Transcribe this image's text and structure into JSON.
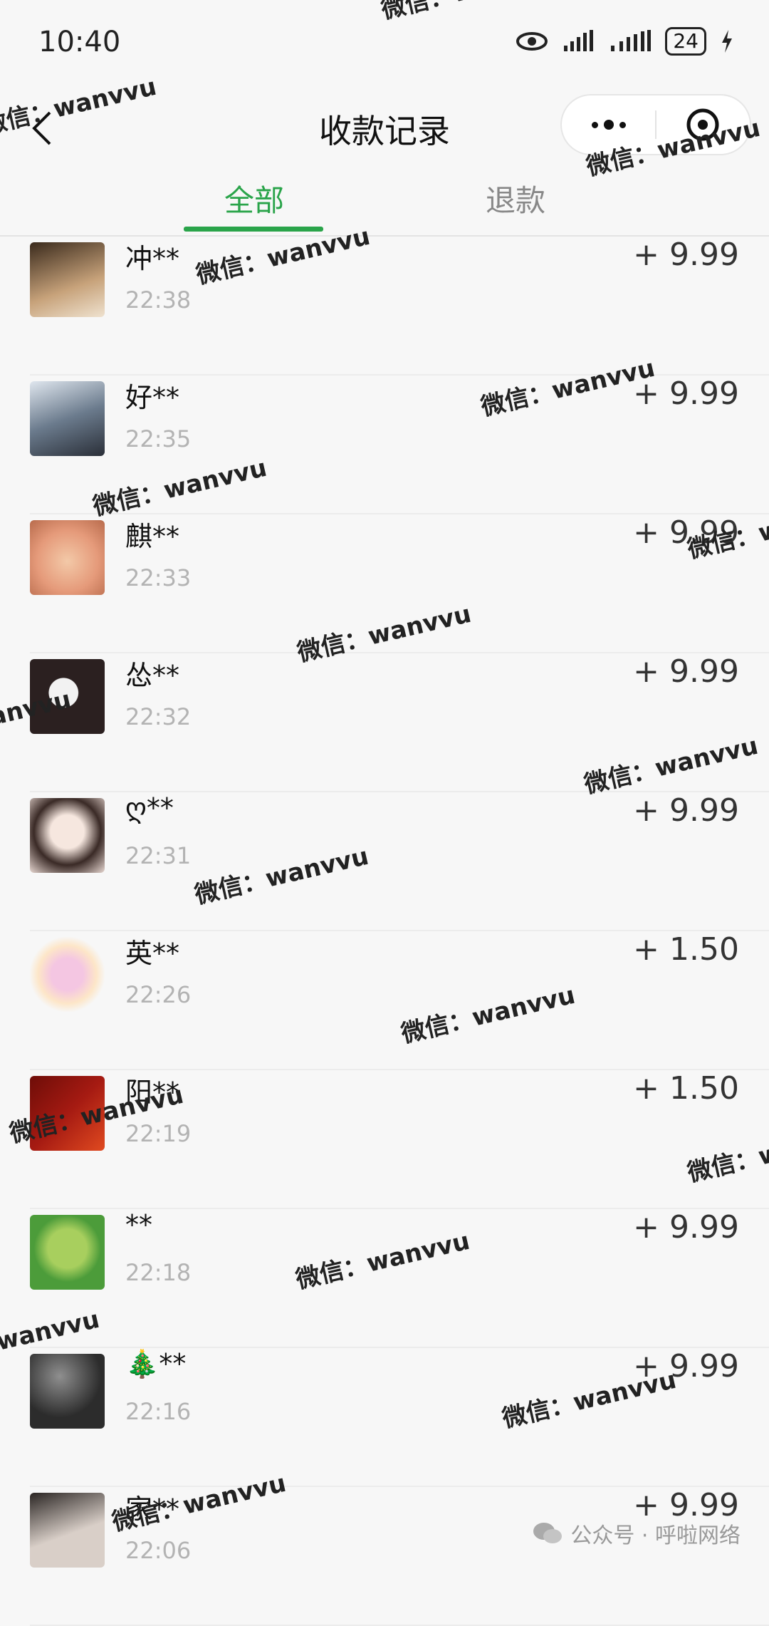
{
  "status": {
    "time": "10:40",
    "battery": "24"
  },
  "nav": {
    "title": "收款记录"
  },
  "tabs": [
    {
      "label": "全部"
    },
    {
      "label": "退款"
    }
  ],
  "records": [
    {
      "name": "冲**",
      "time": "22:38",
      "amount": "+ 9.99",
      "avatar_color": "#c7a27a"
    },
    {
      "name": "好**",
      "time": "22:35",
      "amount": "+ 9.99",
      "avatar_color": "#6b7b8d"
    },
    {
      "name": "麒**",
      "time": "22:33",
      "amount": "+ 9.99",
      "avatar_color": "#e59a7a"
    },
    {
      "name": "怂**",
      "time": "22:32",
      "amount": "+ 9.99",
      "avatar_color": "#2b2020"
    },
    {
      "name": "ღ**",
      "time": "22:31",
      "amount": "+ 9.99",
      "avatar_color": "#e8d8d2"
    },
    {
      "name": "英**",
      "time": "22:26",
      "amount": "+ 1.50",
      "avatar_color": "#f4c6e2"
    },
    {
      "name": "阳**",
      "time": "22:19",
      "amount": "+ 1.50",
      "avatar_color": "#a51a12"
    },
    {
      "name": " **",
      "time": "22:18",
      "amount": "+ 9.99",
      "avatar_color": "#4c9c3a"
    },
    {
      "name": "🎄**",
      "time": "22:16",
      "amount": "+ 9.99",
      "avatar_color": "#2c2c2c"
    },
    {
      "name": "家**",
      "time": "22:06",
      "amount": "+ 9.99",
      "avatar_color": "#d9cfc8"
    }
  ],
  "watermark": "微信：wanvvu",
  "footer": {
    "label": "公众号 · 呼啦网络"
  },
  "colors": {
    "accent": "#2aa44a",
    "background": "#f7f7f7"
  }
}
